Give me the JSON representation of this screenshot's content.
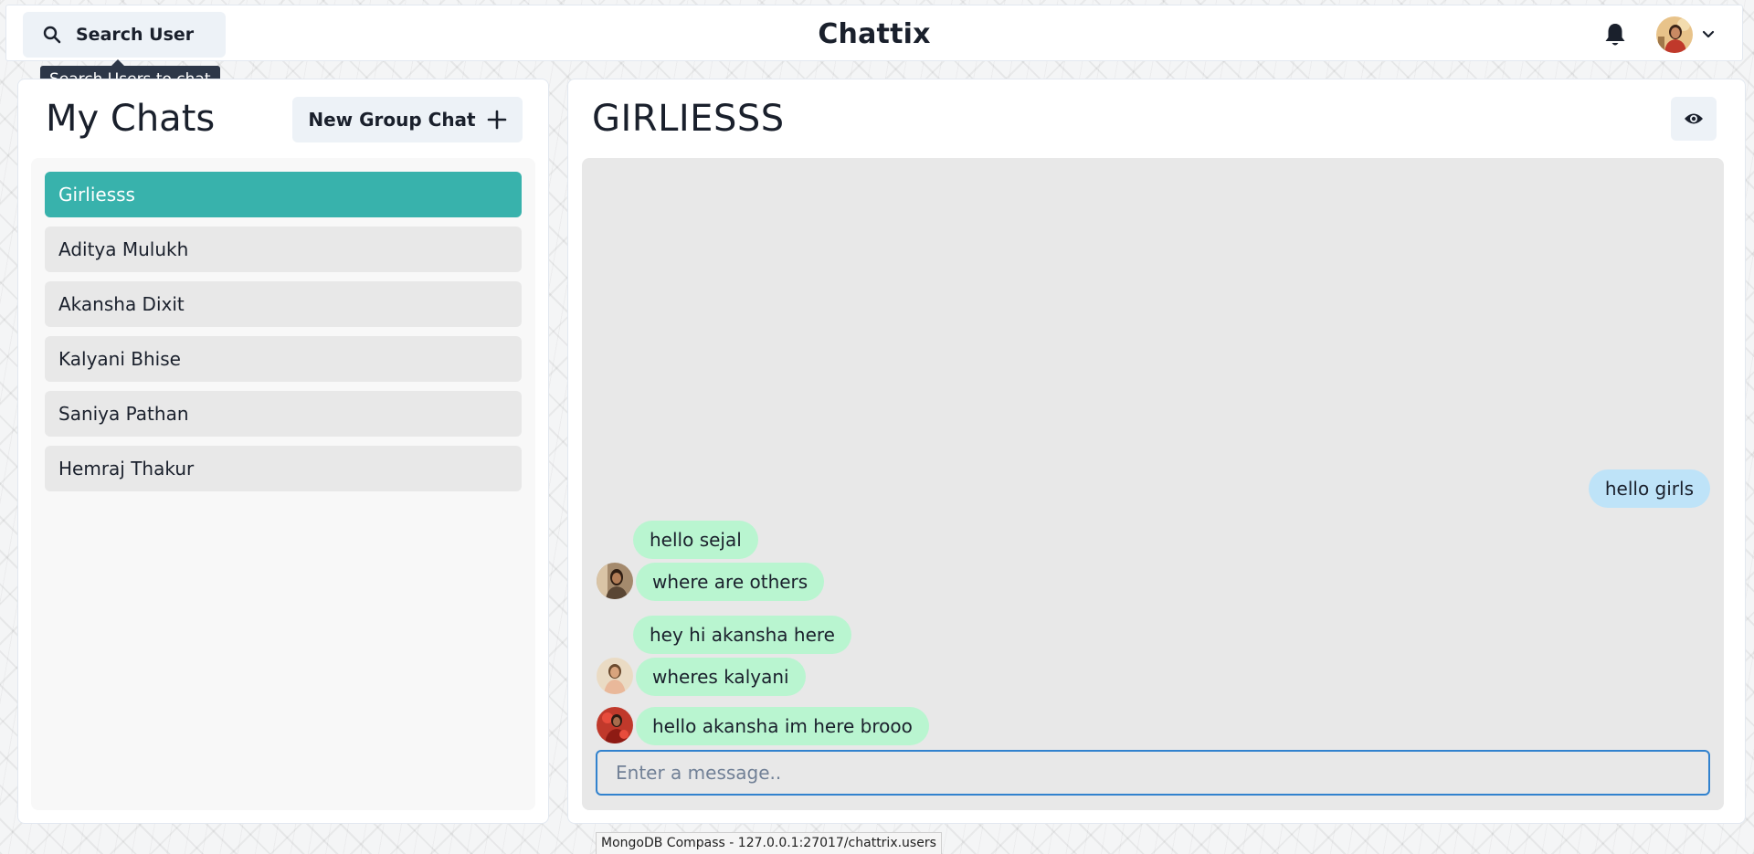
{
  "header": {
    "search_label": "Search User",
    "app_title": "Chattix",
    "tooltip": "Search Users to chat"
  },
  "icons": {
    "search": "search-icon",
    "bell": "bell-icon",
    "chevron": "chevron-down-icon",
    "plus": "plus-icon",
    "eye": "eye-icon"
  },
  "chats_panel": {
    "title": "My Chats",
    "new_group_label": "New Group Chat",
    "items": [
      {
        "label": "Girliesss",
        "active": true
      },
      {
        "label": "Aditya Mulukh",
        "active": false
      },
      {
        "label": "Akansha Dixit",
        "active": false
      },
      {
        "label": "Kalyani Bhise",
        "active": false
      },
      {
        "label": "Saniya Pathan",
        "active": false
      },
      {
        "label": "Hemraj Thakur",
        "active": false
      }
    ]
  },
  "chat_window": {
    "title": "GIRLIESSS",
    "messages": [
      {
        "text": "hello girls",
        "mine": true,
        "sender_avatar_shown": false
      },
      {
        "text": "hello sejal",
        "mine": false,
        "sender_avatar_shown": false
      },
      {
        "text": "where are others",
        "mine": false,
        "sender_avatar_shown": true
      },
      {
        "text": "hey hi akansha here",
        "mine": false,
        "sender_avatar_shown": false
      },
      {
        "text": "wheres kalyani",
        "mine": false,
        "sender_avatar_shown": true
      },
      {
        "text": "hello akansha im here brooo",
        "mine": false,
        "sender_avatar_shown": true
      }
    ],
    "input_placeholder": "Enter a message..",
    "input_value": ""
  },
  "status_bar": {
    "text": "MongoDB Compass - 127.0.0.1:27017/chattrix.users"
  },
  "colors": {
    "accent": "#38b2ac",
    "mine_bubble": "#bee3f8",
    "their_bubble": "#b9f5d0",
    "input_focus": "#3182ce"
  }
}
